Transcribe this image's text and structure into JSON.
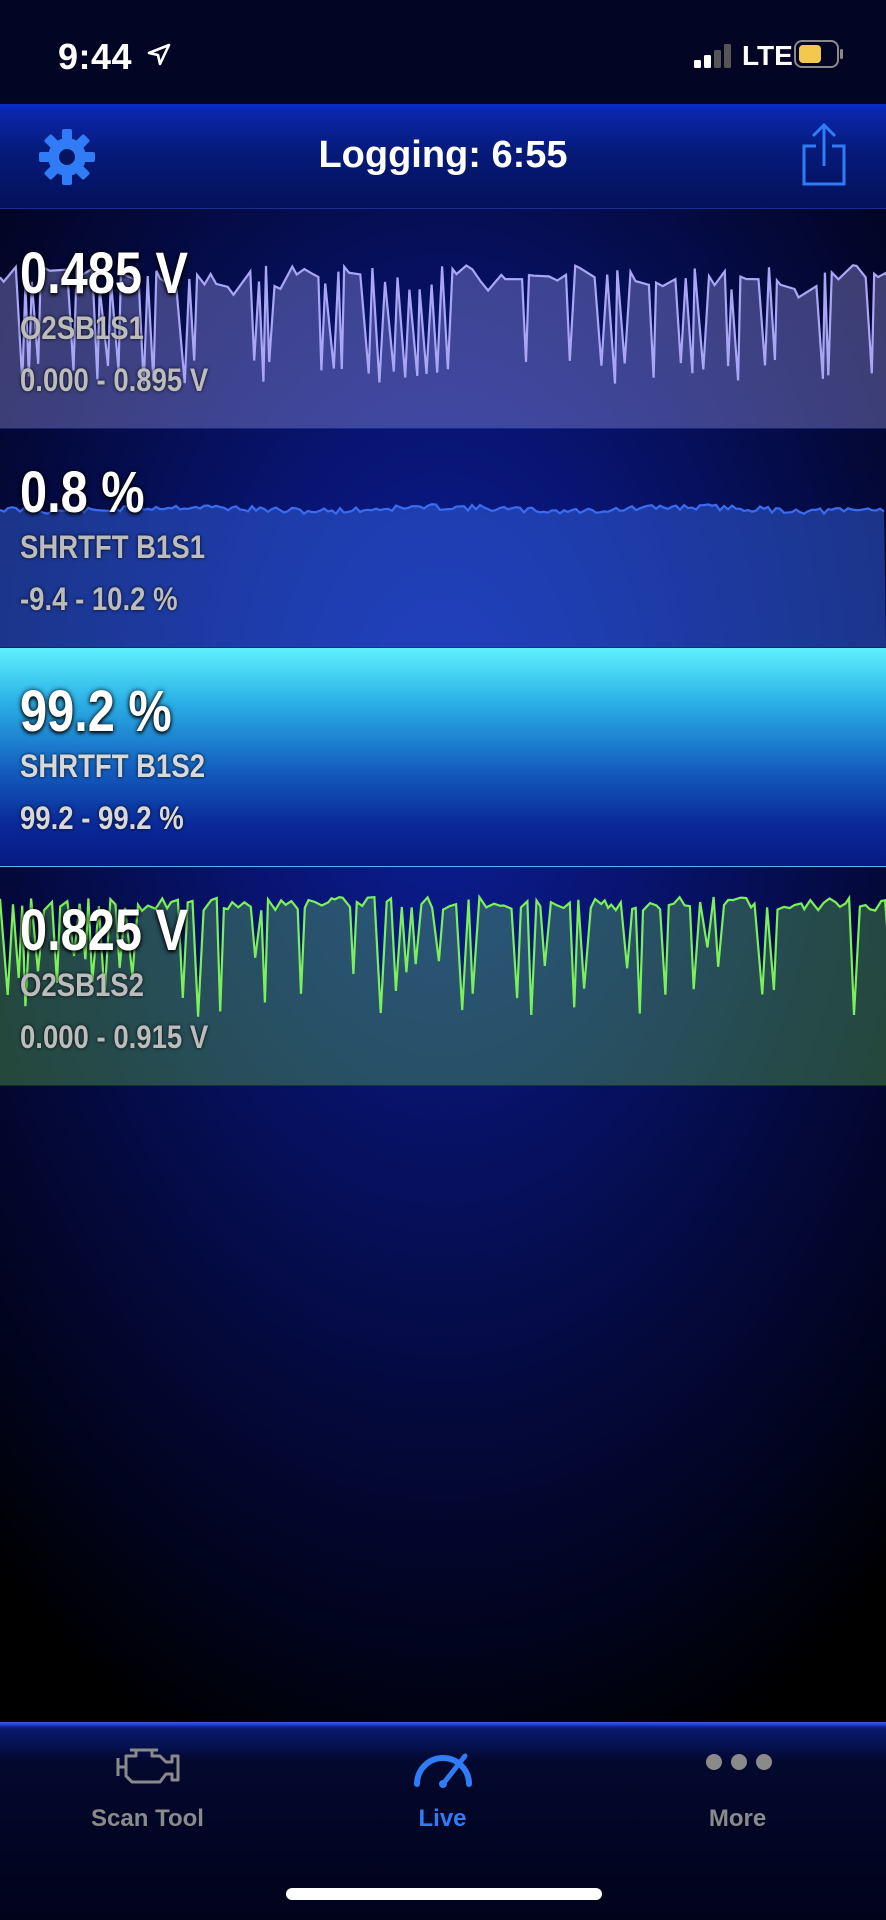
{
  "status_bar": {
    "time": "9:44",
    "carrier": "LTE",
    "signal_bars": 2,
    "battery_color": "#f2c94c"
  },
  "header": {
    "title": "Logging:  6:55",
    "settings_icon": "gear-icon",
    "share_icon": "share-icon"
  },
  "gauges": [
    {
      "value": "0.485 V",
      "name": "O2SB1S1",
      "range": "0.000 - 0.895 V",
      "color": "#a9a7f5",
      "selected": false
    },
    {
      "value": "0.8 %",
      "name": "SHRTFT B1S1",
      "range": "-9.4 - 10.2 %",
      "color": "#3a6cf0",
      "selected": false
    },
    {
      "value": "99.2 %",
      "name": "SHRTFT B1S2",
      "range": "99.2 - 99.2 %",
      "color": "#5ff0ff",
      "selected": true
    },
    {
      "value": "0.825 V",
      "name": "O2SB1S2",
      "range": "0.000 - 0.915 V",
      "color": "#7cf05a",
      "selected": false
    }
  ],
  "tabs": [
    {
      "label": "Scan Tool",
      "icon": "engine-icon",
      "active": false
    },
    {
      "label": "Live",
      "icon": "speedometer-icon",
      "active": true
    },
    {
      "label": "More",
      "icon": "more-icon",
      "active": false
    }
  ],
  "colors": {
    "accent": "#2f7cf6",
    "inactive": "#8a8a8a"
  }
}
